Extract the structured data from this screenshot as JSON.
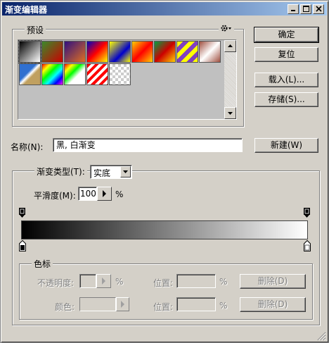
{
  "window": {
    "title": "渐变编辑器"
  },
  "presets": {
    "label": "预设",
    "menu_icon": "gear-icon",
    "swatches": [
      "linear-gradient(135deg,#000,#fff)",
      "linear-gradient(135deg,#3a8a2a,#c00)",
      "linear-gradient(135deg,#301080,#e07020)",
      "linear-gradient(135deg,#0000c0,#f00,#ff0)",
      "linear-gradient(135deg,#ff0 0%,#00c 60%,#ff0 100%)",
      "linear-gradient(135deg,#ffd000,#f00,#ffd000)",
      "linear-gradient(135deg,#00a040,#c00,#ffd000)",
      "repeating-linear-gradient(135deg,#ff0 0 6px,#8040c0 6px 12px)",
      "linear-gradient(135deg,#a05040,#fff,#a05040)",
      "linear-gradient(135deg,#3070d0 40%,#fff 50%,#c0a060 60%)",
      "linear-gradient(135deg,#f00,#ff0,#0f0,#0ff,#00f,#f0f)",
      "linear-gradient(135deg,#f00 0%,#ff0 20%,#0f0 40%,#fff 60%,#fff 100%)",
      "repeating-linear-gradient(135deg,#f00 0 4px,#fff 4px 8px)",
      "repeating-conic-gradient(#ccc 0 25%,#fff 0 50%) 0 0/8px 8px"
    ]
  },
  "buttons": {
    "ok": "确定",
    "reset": "复位",
    "load": "载入(L)...",
    "save": "存储(S)...",
    "new": "新建(W)"
  },
  "name_field": {
    "label": "名称(N):",
    "value": "黑, 白渐变"
  },
  "gradient": {
    "type_label": "渐变类型(T):",
    "type_value": "实底",
    "smoothness_label": "平滑度(M):",
    "smoothness_value": "100",
    "smoothness_unit": "%"
  },
  "color_stops": {
    "label": "色标",
    "opacity_label": "不透明度:",
    "opacity_unit": "%",
    "position_label": "位置:",
    "position_unit": "%",
    "delete_label": "删除(D)",
    "color_label": "颜色:",
    "position_label_2": "位置:",
    "position_unit_2": "%",
    "delete_label_2": "删除(D)"
  }
}
